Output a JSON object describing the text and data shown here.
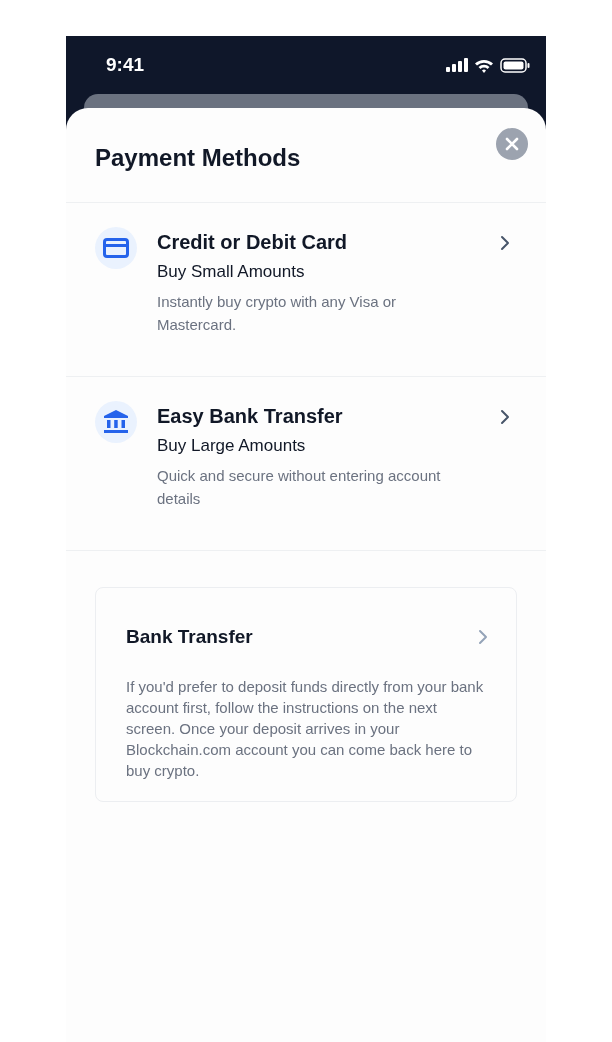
{
  "status_bar": {
    "time": "9:41"
  },
  "sheet": {
    "title": "Payment Methods"
  },
  "methods": [
    {
      "kind": "card",
      "title": "Credit or Debit Card",
      "subtitle": "Buy Small Amounts",
      "description": "Instantly buy crypto with any Visa or Mastercard."
    },
    {
      "kind": "bank",
      "title": "Easy Bank Transfer",
      "subtitle": "Buy Large Amounts",
      "description": "Quick and secure without entering account details"
    }
  ],
  "bank_transfer_card": {
    "title": "Bank Transfer",
    "description": "If you'd prefer to deposit funds directly from your bank account first, follow the instructions on the next screen. Once your deposit arrives in your Blockchain.com account you can come back here to buy crypto."
  }
}
